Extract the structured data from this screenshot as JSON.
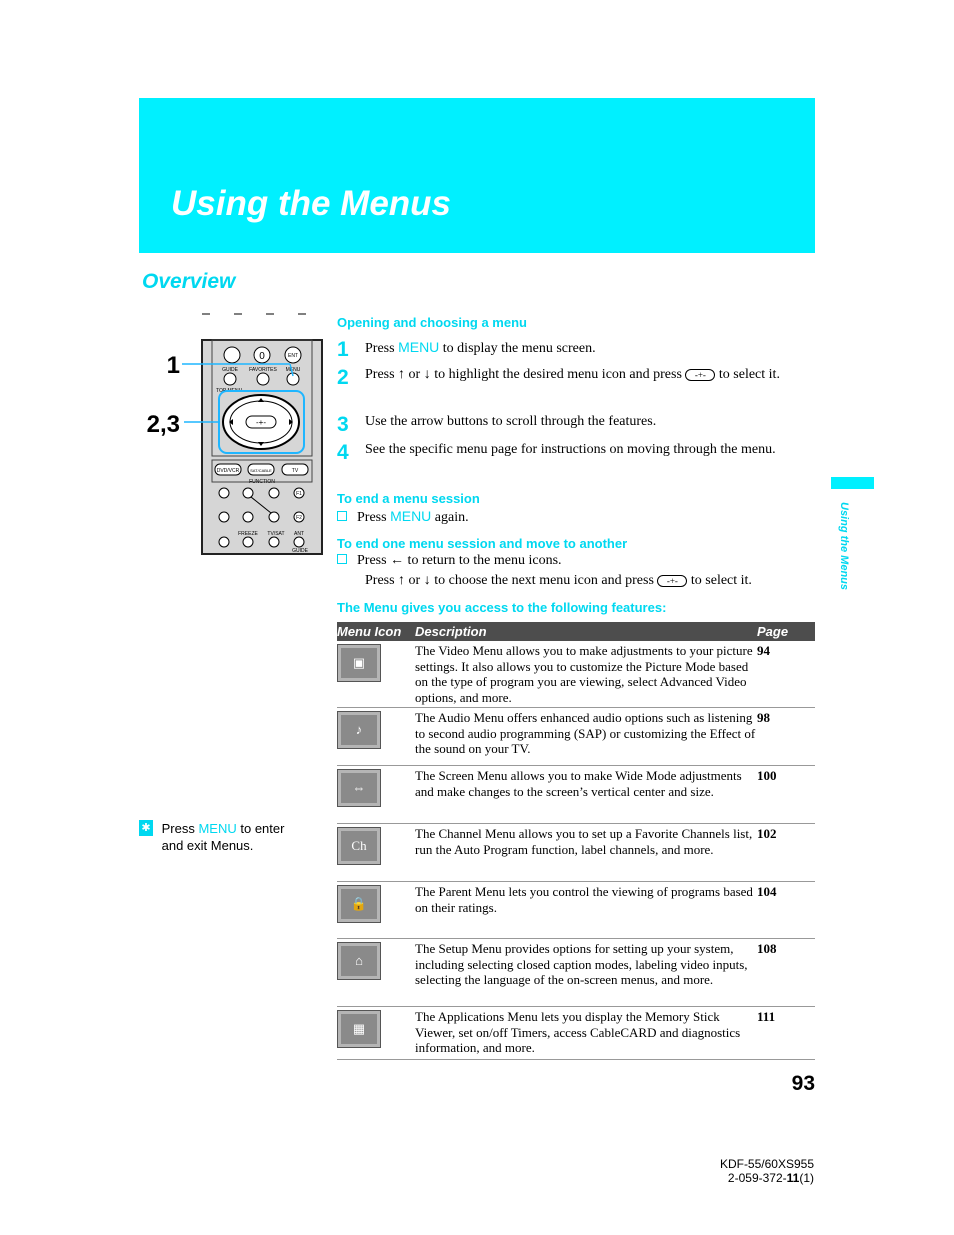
{
  "header": {
    "title": "Using the Menus"
  },
  "section_title": "Overview",
  "side_tab": "Using the Menus",
  "remote": {
    "callout_1": "1",
    "callout_2": "2,3",
    "labels": {
      "guide": "GUIDE",
      "favorites": "FAVORITES",
      "menu": "MENU",
      "top_menu": "TOP MENU",
      "ent": "ENT",
      "zero": "0",
      "dvd_vcr": "DVD/VCR",
      "sat_cable": "SAT/CABLE",
      "tv": "TV",
      "function": "FUNCTION",
      "f1": "F1",
      "f2": "F2",
      "freeze": "FREEZE",
      "tv_sat": "TV/SAT",
      "ant": "ANT",
      "guide2": "GUIDE"
    }
  },
  "opening": {
    "heading": "Opening and choosing a menu",
    "steps": [
      {
        "num": "1",
        "pre": "Press ",
        "menu": "MENU",
        "post": " to display the menu screen."
      },
      {
        "num": "2",
        "pre": "Press ↑ or ↓ to highlight the desired menu icon and press ",
        "post": " to select it."
      },
      {
        "num": "3",
        "text": "Use the arrow buttons to scroll through the features."
      },
      {
        "num": "4",
        "text": "See the specific menu page for instructions on moving through the menu."
      }
    ]
  },
  "end_session": {
    "heading": "To end a menu session",
    "pre": "Press ",
    "menu": "MENU",
    "post": " again."
  },
  "end_one": {
    "heading": "To end one menu session and move to another",
    "line1": "Press ← to return to the menu icons.",
    "line2_pre": "Press ↑ or ↓ to choose the next menu icon and press ",
    "line2_post": " to select it."
  },
  "select_button_glyph": "-+-",
  "features": {
    "heading": "The Menu gives you access to the following features:",
    "columns": [
      "Menu Icon",
      "Description",
      "Page"
    ],
    "rows": [
      {
        "icon": "video-menu-icon",
        "desc": "The Video Menu allows you to make adjustments to your picture settings. It also allows you to customize the Picture Mode based on the type of program you are viewing, select Advanced Video options, and more.",
        "page": "94"
      },
      {
        "icon": "audio-menu-icon",
        "desc": "The Audio Menu offers enhanced audio options such as listening to second audio programming (SAP) or customizing the Effect of the sound on your TV.",
        "page": "98"
      },
      {
        "icon": "screen-menu-icon",
        "desc": "The Screen Menu allows you to make Wide Mode adjustments and make changes to the screen’s vertical center and size.",
        "page": "100"
      },
      {
        "icon": "channel-menu-icon",
        "desc": "The Channel Menu allows you to set up a Favorite Channels list, run the Auto Program function, label channels, and more.",
        "page": "102"
      },
      {
        "icon": "parent-menu-icon",
        "desc": "The Parent Menu lets you control the viewing of programs based on their ratings.",
        "page": "104"
      },
      {
        "icon": "setup-menu-icon",
        "desc": "The Setup Menu provides options for setting up your system, including selecting closed caption modes, labeling video inputs, selecting the language of the on-screen menus, and more.",
        "page": "108"
      },
      {
        "icon": "applications-menu-icon",
        "desc": "The Applications Menu lets you display the Memory Stick Viewer, set on/off Timers, access CableCARD and diagnostics information, and more.",
        "page": "111"
      }
    ]
  },
  "tip": {
    "pre": "Press ",
    "menu": "MENU",
    "post": " to enter and exit Menus."
  },
  "page_number": "93",
  "footer": {
    "model": "KDF-55/60XS955",
    "code_pre": "2-059-372-",
    "code_bold": "11",
    "code_post": "(1)"
  },
  "colors": {
    "accent": "#00f0ff",
    "table_header": "#4d4d4d"
  }
}
